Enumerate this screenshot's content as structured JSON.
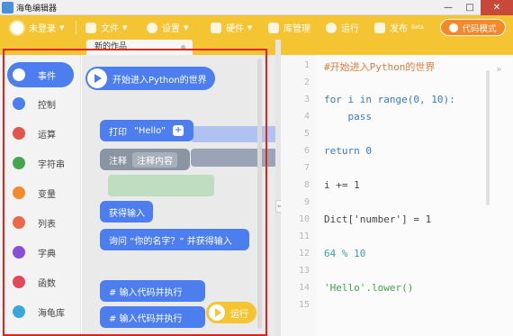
{
  "window": {
    "title": "海龟编辑器"
  },
  "toolbar": {
    "login": "未登录",
    "file": "文件",
    "settings": "设置",
    "hardware": "硬件",
    "library": "库管理",
    "run": "运行",
    "publish": "发布",
    "code_mode": "代码模式"
  },
  "tabs": [
    {
      "label": "新的作品"
    }
  ],
  "categories": [
    {
      "label": "事件",
      "color": "#4c7ef0",
      "active": true
    },
    {
      "label": "控制",
      "color": "#4c7ef0"
    },
    {
      "label": "运算",
      "color": "#e0564a"
    },
    {
      "label": "字符串",
      "color": "#44a64c"
    },
    {
      "label": "变量",
      "color": "#f28a2e"
    },
    {
      "label": "列表",
      "color": "#e86a4a"
    },
    {
      "label": "字典",
      "color": "#8a4fd6"
    },
    {
      "label": "函数",
      "color": "#e04a5a"
    },
    {
      "label": "海龟库",
      "color": "#3aa7d6"
    }
  ],
  "blocks": {
    "start": "开始进入Python的世界",
    "print_prefix": "打印",
    "print_value": "“Hello”",
    "plus": "+",
    "comment_prefix": "注释",
    "comment_value": "注释内容",
    "get_input": "获得输入",
    "ask": "询问 “你的名字？” 并获得输入",
    "exec1": "# 输入代码并执行",
    "exec2": "# 输入代码并执行",
    "run": "运行"
  },
  "code": {
    "line_numbers": [
      "1",
      "2",
      "3",
      "4",
      "5",
      "6",
      "7",
      "8",
      "9",
      "10",
      "11",
      "12",
      "13",
      "14",
      "15"
    ],
    "lines": [
      "#开始进入Python的世界",
      "",
      "for i in range(0, 10):",
      "    pass",
      "",
      "return 0",
      "",
      "i += 1",
      "",
      "Dict['number'] = 1",
      "",
      "64 % 10",
      "",
      "'Hello'.lower()",
      ""
    ]
  }
}
